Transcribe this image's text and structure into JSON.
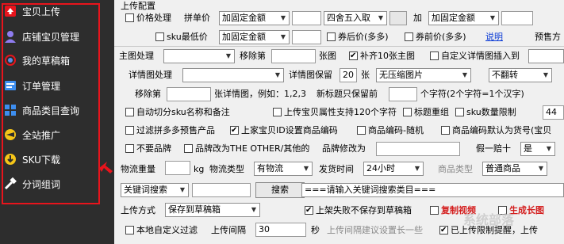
{
  "sidebar": {
    "items": [
      {
        "label": "宝贝上传",
        "icon": "upload-icon"
      },
      {
        "label": "店铺宝贝管理",
        "icon": "user-icon"
      },
      {
        "label": "我的草稿箱",
        "icon": "draft-icon"
      },
      {
        "label": "订单管理",
        "icon": "order-icon"
      },
      {
        "label": "商品类目查询",
        "icon": "grid-icon"
      },
      {
        "label": "全站推广",
        "icon": "promo-icon"
      },
      {
        "label": "SKU下载",
        "icon": "download-icon"
      },
      {
        "label": "分词组词",
        "icon": "hammer-icon"
      }
    ],
    "highlight_color": "#e8141c"
  },
  "upload_config": {
    "section_title": "上传配置",
    "price_process_label": "价格处理",
    "pin_price_label": "拼单价",
    "add_fixed_amount": "加固定金额",
    "round_mode": "四舍五入取",
    "add_label": "加",
    "add_fixed_amount_2": "加固定金额",
    "sku_min_price_label": "sku最低价",
    "add_fixed_amount_3": "加固定金额",
    "coupon_after_price": "券后价(多多)",
    "coupon_before_price": "券前价(多多)",
    "explain_link": "说明",
    "presale_label": "预售方"
  },
  "main_image": {
    "label": "主图处理",
    "remove_label": "移除第",
    "zhang_label": "张图",
    "fill10_label": "补齐10张主图",
    "custom_detail_label": "自定义详情图插入到"
  },
  "detail_image": {
    "label": "详情图处理",
    "keep_label": "详情图保留",
    "keep_count": "20",
    "zhang": "张",
    "no_compress": "无压缩图片",
    "no_flip": "不翻转"
  },
  "remove_row": {
    "remove_label": "移除第",
    "hint": "张详情图，例如：1,2,3",
    "title_keep_label": "新标题只保留前",
    "char_hint": "个字符(2个字符=1个汉字)"
  },
  "options": {
    "auto_cut_sku": "自动切分sku名称和备注",
    "upload_attr_120": "上传宝贝属性支持120个字符",
    "title_regroup": "标题重组",
    "sku_limit_label": "sku数量限制",
    "sku_limit_value": "44",
    "filter_presale": "过滤拼多多预售产品",
    "set_code_by_id": "上家宝贝ID设置商品编码",
    "code_random": "商品编码-随机",
    "code_default_goods": "商品编码默认为货号(宝贝",
    "no_brand": "不要品牌",
    "brand_to_other": "品牌改为THE OTHER/其他的",
    "brand_change_label": "品牌修改为",
    "fake_label": "假一赔十",
    "fake_value": "是"
  },
  "logistics": {
    "weight_label": "物流重量",
    "kg": "kg",
    "type_label": "物流类型",
    "type_value": "有物流",
    "ship_time_label": "发货时间",
    "ship_time_value": "24小时",
    "goods_type_label": "商品类型",
    "goods_type_value": "普通商品"
  },
  "search": {
    "keyword_select": "关键词搜索",
    "search_button": "搜索",
    "category_placeholder": "===请输入关键词搜索类目==="
  },
  "upload": {
    "mode_label": "上传方式",
    "mode_value": "保存到草稿箱",
    "fail_not_save": "上架失败不保存到草稿箱",
    "copy_video": "复制视频",
    "gen_long_image": "生成长图",
    "local_filter": "本地自定义过滤",
    "interval_label": "上传间隔",
    "interval_value": "30",
    "seconds": "秒",
    "interval_hint": "上传间隔建议设置长一些",
    "limit_hint": "已上传限制提醒，上传"
  },
  "watermark": "系统部落"
}
